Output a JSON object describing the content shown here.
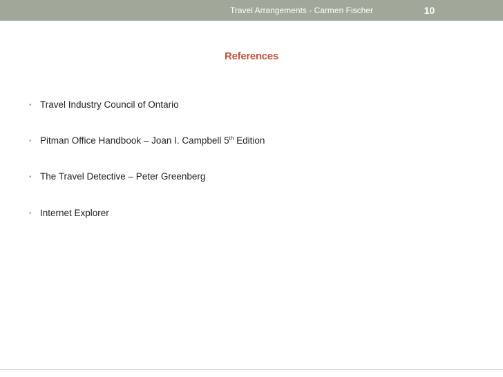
{
  "header": {
    "title": "Travel Arrangements - Carmen Fischer",
    "page_number": "10"
  },
  "slide": {
    "title": "References",
    "bullets": [
      {
        "text": "Travel Industry Council of Ontario"
      },
      {
        "text_before": "Pitman Office Handbook – Joan I. Campbell 5",
        "superscript": "th",
        "text_after": " Edition"
      },
      {
        "text": "The Travel Detective – Peter Greenberg"
      },
      {
        "text": "Internet Explorer"
      }
    ]
  },
  "colors": {
    "header_bar": "#9fa899",
    "title": "#c0553a",
    "body_text": "#222222"
  },
  "icons": {
    "bullet": "bullet-dot-icon"
  }
}
